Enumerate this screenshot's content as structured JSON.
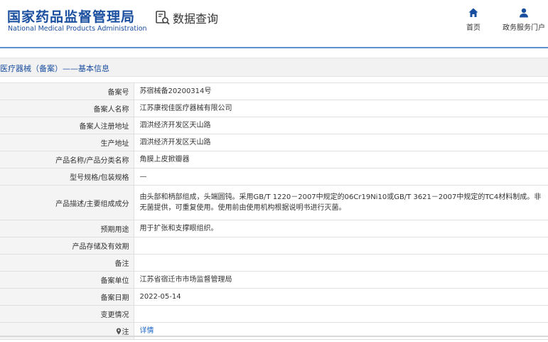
{
  "header": {
    "logo_cn": "国家药品监督管理局",
    "logo_en": "National Medical Products Administration",
    "query_title": "数据查询",
    "nav": {
      "home": "首页",
      "service": "政务服务门户"
    }
  },
  "breadcrumb": "医疗器械（备案）——基本信息",
  "rows": [
    {
      "label": "备案号",
      "value": "苏宿械备20200314号"
    },
    {
      "label": "备案人名称",
      "value": "江苏康视佳医疗器械有限公司"
    },
    {
      "label": "备案人注册地址",
      "value": "泗洪经济开发区天山路"
    },
    {
      "label": "生产地址",
      "value": "泗洪经济开发区天山路"
    },
    {
      "label": "产品名称/产品分类名称",
      "value": "角膜上皮掀瓣器"
    },
    {
      "label": "型号规格/包装规格",
      "value": "—"
    },
    {
      "label": "产品描述/主要组成成分",
      "value": "由头部和柄部组成，头端圆钝。采用GB/T 1220－2007中规定的06Cr19Ni10或GB/T 3621－2007中规定的TC4材料制成。非无菌提供，可重复使用。使用前由使用机构根据说明书进行灭菌。"
    },
    {
      "label": "预期用途",
      "value": "用于扩张和支撑眼组织。"
    },
    {
      "label": "产品存储及有效期",
      "value": ""
    },
    {
      "label": "备注",
      "value": ""
    },
    {
      "label": "备案单位",
      "value": "江苏省宿迁市市场监督管理局"
    },
    {
      "label": "备案日期",
      "value": "2022-05-14"
    },
    {
      "label": "变更情况",
      "value": ""
    },
    {
      "label": "注",
      "value": "详情",
      "icon": "location-pin-icon"
    }
  ],
  "colors": {
    "brand_blue": "#1a4fa0",
    "link_blue": "#1a66c8",
    "label_bg": "#f4f4f4",
    "rule_blue": "#5a8fd0"
  }
}
